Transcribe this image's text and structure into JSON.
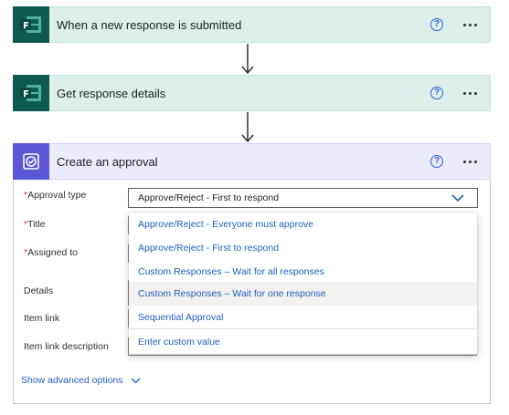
{
  "steps": [
    {
      "title": "When a new response is submitted",
      "help": "?"
    },
    {
      "title": "Get response details",
      "help": "?"
    },
    {
      "title": "Create an approval",
      "help": "?"
    }
  ],
  "approval": {
    "fields": {
      "approval_type": {
        "required_mark": "*",
        "label": "Approval type",
        "value": "Approve/Reject - First to respond"
      },
      "title": {
        "required_mark": "*",
        "label": "Title"
      },
      "assigned_to": {
        "required_mark": "*",
        "label": "Assigned to"
      },
      "details": {
        "label": "Details"
      },
      "item_link": {
        "label": "Item link"
      },
      "item_link_description": {
        "label": "Item link description"
      }
    },
    "dropdown_options": [
      "Approve/Reject - Everyone must approve",
      "Approve/Reject - First to respond",
      "Custom Responses – Wait for all responses",
      "Custom Responses – Wait for one response",
      "Sequential Approval"
    ],
    "custom_value_option": "Enter custom value",
    "show_advanced": "Show advanced options"
  },
  "colors": {
    "forms_icon_bg": "#0e5a4e",
    "forms_header_bg": "#dcefea",
    "approval_icon_bg": "#5a56d6",
    "approval_header_bg": "#ecebfb",
    "link_blue": "#1f5fbf",
    "required_red": "#d13438"
  },
  "icons": {
    "forms": "microsoft-forms-icon",
    "approval": "approvals-icon",
    "help": "help-circle-icon",
    "more": "more-horizontal-icon",
    "arrow": "arrow-down-icon",
    "chevron": "chevron-down-icon"
  }
}
